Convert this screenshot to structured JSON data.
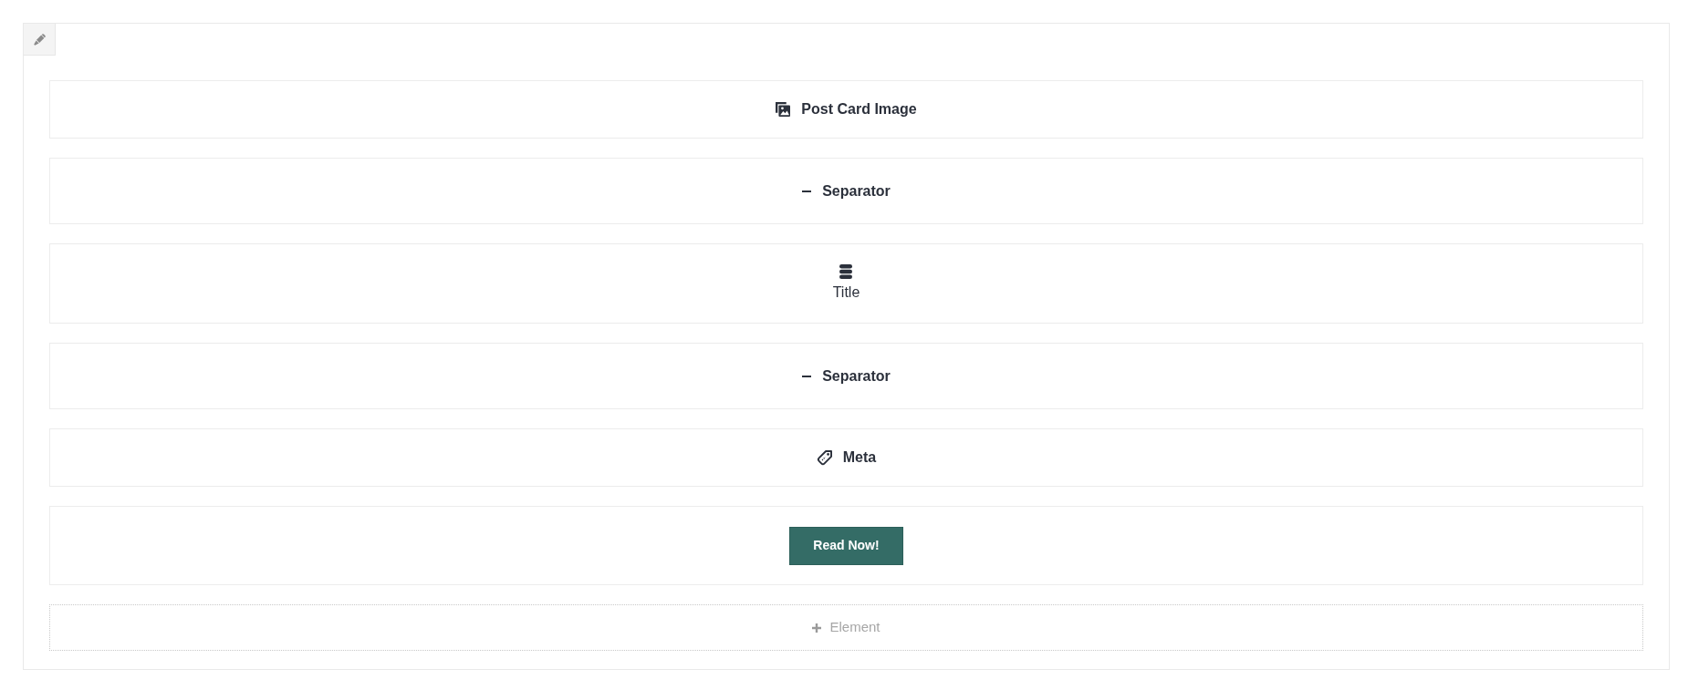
{
  "elements": [
    {
      "kind": "image",
      "label": "Post Card Image"
    },
    {
      "kind": "separator",
      "label": "Separator"
    },
    {
      "kind": "title",
      "label": "Title"
    },
    {
      "kind": "separator",
      "label": "Separator"
    },
    {
      "kind": "meta",
      "label": "Meta"
    },
    {
      "kind": "button",
      "label": "Read Now!"
    }
  ],
  "add_element": {
    "label": "Element"
  }
}
